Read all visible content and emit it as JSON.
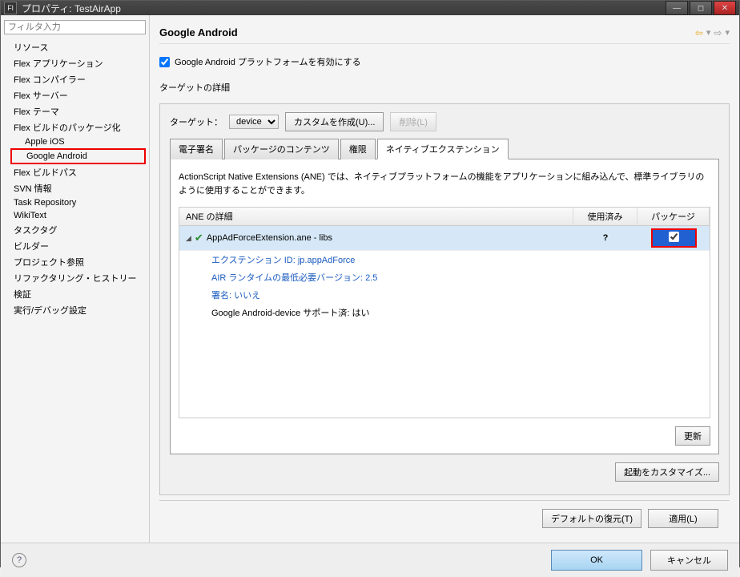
{
  "window": {
    "title": "プロパティ: TestAirApp"
  },
  "sidebar": {
    "filter_placeholder": "フィルタ入力",
    "items": [
      "リソース",
      "Flex アプリケーション",
      "Flex コンパイラー",
      "Flex サーバー",
      "Flex テーマ",
      "Flex ビルドのパッケージ化",
      "Apple iOS",
      "Google Android",
      "Flex ビルドパス",
      "SVN 情報",
      "Task Repository",
      "WikiText",
      "タスクタグ",
      "ビルダー",
      "プロジェクト参照",
      "リファクタリング・ヒストリー",
      "検証",
      "実行/デバッグ設定"
    ]
  },
  "header": {
    "title": "Google Android"
  },
  "enable": {
    "label": "Google Android プラットフォームを有効にする"
  },
  "section": {
    "title": "ターゲットの詳細"
  },
  "target": {
    "label": "ターゲット：",
    "selected": "device",
    "custom_btn": "カスタムを作成(U)...",
    "delete_btn": "削除(L)"
  },
  "tabs": [
    "電子署名",
    "パッケージのコンテンツ",
    "権限",
    "ネイティブエクステンション"
  ],
  "tab_desc": "ActionScript Native Extensions (ANE) では、ネイティブプラットフォームの機能をアプリケーションに組み込んで、標準ライブラリのように使用することができます。",
  "table": {
    "headers": [
      "ANE の詳細",
      "使用済み",
      "パッケージ"
    ],
    "row": {
      "name": "AppAdForceExtension.ane - libs",
      "used": "?",
      "details": [
        "エクステンション ID: jp.appAdForce",
        "AIR ランタイムの最低必要バージョン: 2.5",
        "署名: いいえ",
        "Google Android-device サポート済: はい"
      ]
    }
  },
  "buttons": {
    "update": "更新",
    "customize": "起動をカスタマイズ...",
    "restore": "デフォルトの復元(T)",
    "apply": "適用(L)",
    "ok": "OK",
    "cancel": "キャンセル"
  }
}
